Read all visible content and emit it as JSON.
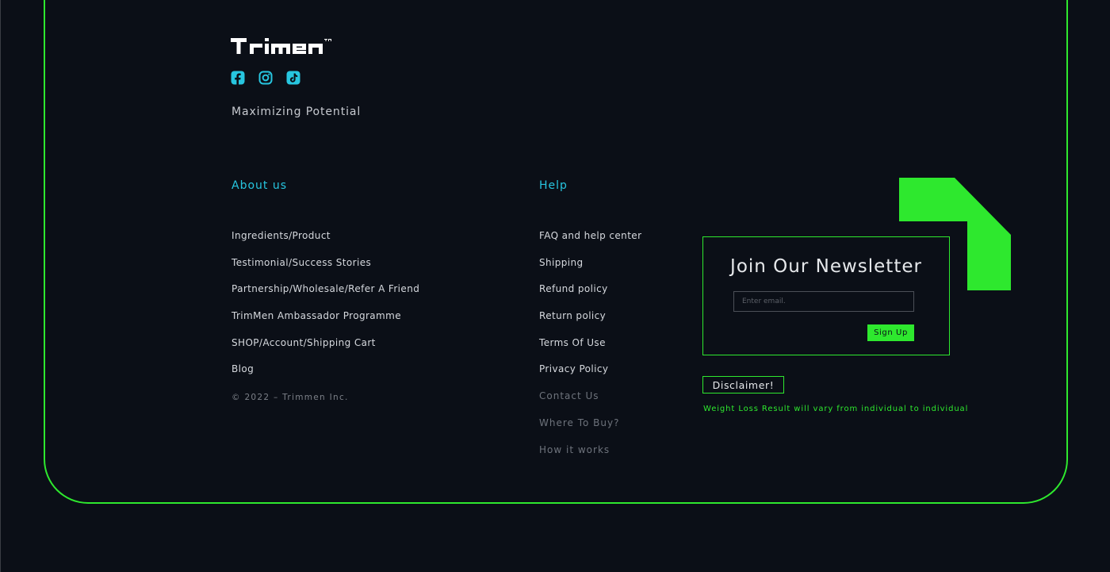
{
  "brand": {
    "logo_text": "Trimen",
    "tagline": "Maximizing Potential"
  },
  "social": [
    {
      "name": "facebook",
      "icon": "facebook-icon"
    },
    {
      "name": "instagram",
      "icon": "instagram-icon"
    },
    {
      "name": "tiktok",
      "icon": "tiktok-icon"
    }
  ],
  "about": {
    "title": "About us",
    "links": [
      "Ingredients/Product",
      "Testimonial/Success Stories",
      "Partnership/Wholesale/Refer A Friend",
      "TrimMen Ambassador Programme",
      "SHOP/Account/Shipping Cart",
      "Blog"
    ],
    "copyright": "© 2022 – Trimmen Inc."
  },
  "help": {
    "title": "Help",
    "links": [
      "FAQ and help center",
      "Shipping",
      "Refund policy",
      "Return policy",
      "Terms Of Use",
      "Privacy Policy"
    ],
    "secondary_links": [
      "Contact Us",
      "Where To Buy?",
      "How it works"
    ]
  },
  "newsletter": {
    "title": "Join Our Newsletter",
    "email_placeholder": "Enter email.",
    "email_value": "",
    "button_label": "Sign Up"
  },
  "disclaimer": {
    "button_label": "Disclaimer!",
    "text": "Weight Loss Result will vary from individual to individual"
  },
  "colors": {
    "background": "#0b0f17",
    "accent_green": "#2ee82e",
    "accent_cyan": "#27c6e0",
    "text": "#d6d9de",
    "muted_text": "#6e737c"
  }
}
